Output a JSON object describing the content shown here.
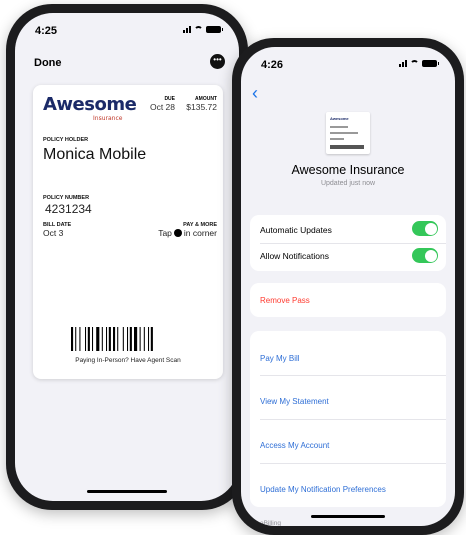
{
  "left_phone": {
    "status": {
      "time": "4:25"
    },
    "done_label": "Done",
    "more_glyph": "•••",
    "pass": {
      "brand": "Awesome",
      "brand_sub": "Insurance",
      "due_label": "DUE",
      "due_value": "Oct 28",
      "amount_label": "AMOUNT",
      "amount_value": "$135.72",
      "holder_label": "POLICY HOLDER",
      "holder_value": "Monica Mobile",
      "number_label": "POLICY NUMBER",
      "number_value": "4231234",
      "bill_date_label": "BILL DATE",
      "bill_date_value": "Oct 3",
      "pay_label": "PAY & MORE",
      "pay_value_pre": "Tap",
      "pay_value_post": "in corner",
      "barcode_caption": "Paying In-Person? Have Agent Scan"
    }
  },
  "right_phone": {
    "status": {
      "time": "4:26"
    },
    "back_glyph": "‹",
    "thumb_brand": "Awesome",
    "title": "Awesome Insurance",
    "subtitle": "Updated just now",
    "settings": [
      {
        "label": "Automatic Updates",
        "on": true
      },
      {
        "label": "Allow Notifications",
        "on": true
      }
    ],
    "remove_label": "Remove Pass",
    "links": [
      "Pay My Bill",
      "View My Statement",
      "Access My Account",
      "Update My Notification Preferences"
    ],
    "footer": "eBilling"
  },
  "colors": {
    "toggle_on": "#34c759",
    "link": "#2f6fd6",
    "destructive": "#ff3b30",
    "brand": "#1b2a68"
  }
}
